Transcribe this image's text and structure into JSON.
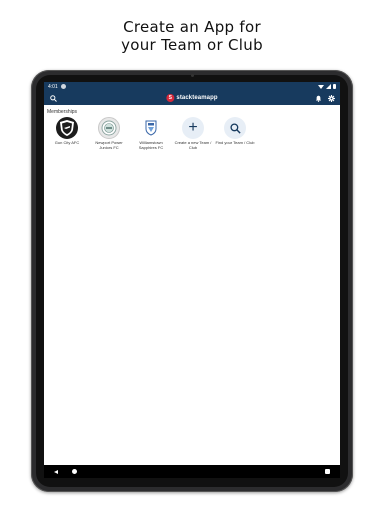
{
  "headline": {
    "line1": "Create an App for",
    "line2": "your Team or Club"
  },
  "statusbar": {
    "time": "4:01"
  },
  "appbar": {
    "brand": "stackteamapp",
    "brand_mark": "S"
  },
  "main": {
    "section_title": "Memberships",
    "memberships": [
      {
        "label": "Gun City AFC",
        "icon": "gun-city-crest"
      },
      {
        "label": "Newport Power Juniors FC",
        "icon": "newport-crest"
      },
      {
        "label": "Williamstown Sapphires FC",
        "icon": "williamstown-crest"
      },
      {
        "label": "Create a new Team / Club",
        "icon": "plus-icon",
        "glyph": "+"
      },
      {
        "label": "Find your Team / Club",
        "icon": "search-icon"
      }
    ]
  },
  "colors": {
    "primary": "#173a5e",
    "brand_red": "#d6283a",
    "action_bg": "#e7eef6"
  }
}
